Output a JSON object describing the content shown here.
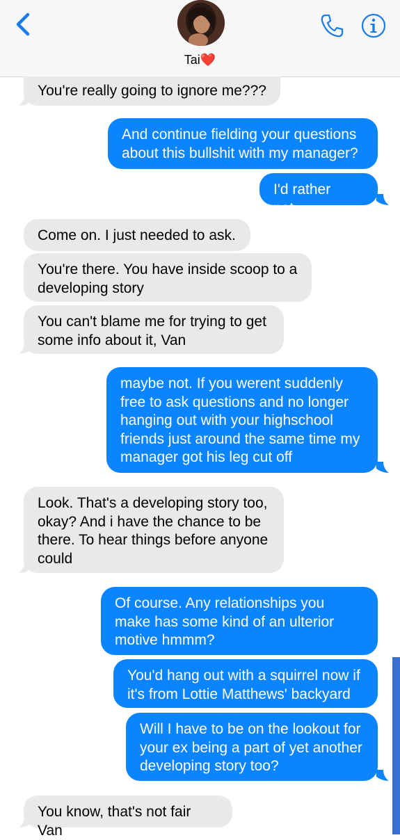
{
  "header": {
    "contact_name": "Tai",
    "contact_emoji": "❤️",
    "icons": {
      "back": "chevron-left-icon",
      "phone": "phone-icon",
      "info": "info-icon"
    }
  },
  "colors": {
    "outgoing": "#0b84ff",
    "incoming": "#e9e9eb",
    "accent": "#1a7bea"
  },
  "messages": [
    {
      "sender": "them",
      "text": "You're really going to ignore me???"
    },
    {
      "sender": "me",
      "text": "And continue fielding your questions about this bullshit with my manager?"
    },
    {
      "sender": "me",
      "text": "I'd rather not..."
    },
    {
      "sender": "them",
      "text": "Come on. I just needed to ask."
    },
    {
      "sender": "them",
      "text": "You're there. You have inside scoop to a developing story"
    },
    {
      "sender": "them",
      "text": "You can't blame me for trying to get some info about it, Van"
    },
    {
      "sender": "me",
      "text": "maybe not. If you werent suddenly free to ask questions and no longer hanging out with your highschool friends just around the same time my manager got his leg cut off"
    },
    {
      "sender": "them",
      "text": "Look. That's a developing story too, okay? And i have the chance to be there. To hear things before anyone could"
    },
    {
      "sender": "me",
      "text": "Of course. Any relationships you make has some kind of an ulterior motive hmmm?"
    },
    {
      "sender": "me",
      "text": "You'd hang out with a squirrel now if it's from Lottie Matthews' backyard"
    },
    {
      "sender": "me",
      "text": "Will I have to be on the lookout for your ex being a part of yet another developing story too?"
    },
    {
      "sender": "them",
      "text": "You know, that's not fair Van"
    }
  ]
}
